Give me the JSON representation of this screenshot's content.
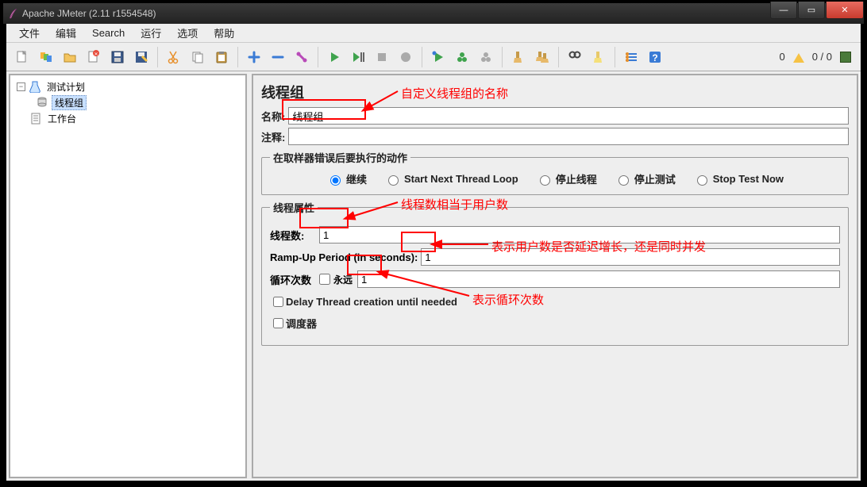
{
  "window": {
    "title": "Apache JMeter (2.11 r1554548)",
    "min_label": "—",
    "max_label": "▭",
    "close_label": "✕"
  },
  "menu": {
    "file": "文件",
    "edit": "编辑",
    "search": "Search",
    "run": "运行",
    "options": "选项",
    "help": "帮助"
  },
  "toolbar": {
    "status_errors": "0",
    "status_threads": "0 / 0"
  },
  "tree": {
    "root": "测试计划",
    "thread_group": "线程组",
    "workbench": "工作台"
  },
  "panel": {
    "heading": "线程组",
    "name_label": "名称:",
    "name_value": "线程组",
    "comment_label": "注释:",
    "comment_value": "",
    "on_error_legend": "在取样器错误后要执行的动作",
    "radio_continue": "继续",
    "radio_start_next": "Start Next Thread Loop",
    "radio_stop_thread": "停止线程",
    "radio_stop_test": "停止测试",
    "radio_stop_now": "Stop Test Now",
    "props_legend": "线程属性",
    "threads_label": "线程数:",
    "threads_value": "1",
    "ramp_label": "Ramp-Up Period (in seconds):",
    "ramp_value": "1",
    "loop_label": "循环次数",
    "loop_forever": "永远",
    "loop_value": "1",
    "delay_creation": "Delay Thread creation until needed",
    "scheduler": "调度器"
  },
  "annotations": {
    "a1": "自定义线程组的名称",
    "a2": "线程数相当于用户数",
    "a3": "表示用户数是否延迟增长，还是同时并发",
    "a4": "表示循环次数"
  }
}
